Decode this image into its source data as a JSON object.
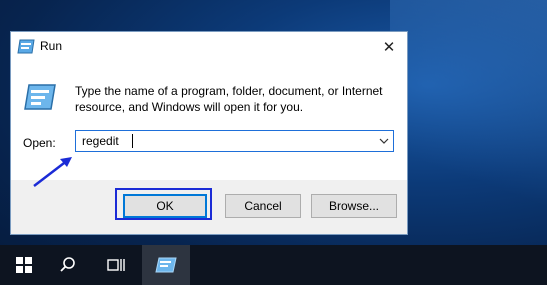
{
  "dialog": {
    "title": "Run",
    "description": "Type the name of a program, folder, document, or Internet resource, and Windows will open it for you.",
    "open_label": "Open:",
    "open_value": "regedit",
    "ok_label": "OK",
    "cancel_label": "Cancel",
    "browse_label": "Browse...",
    "close_glyph": "✕"
  },
  "colors": {
    "accent": "#0078d7",
    "highlight_box": "#1b2bd6",
    "arrow": "#1b2bd6",
    "taskbar": "#0d1420"
  },
  "taskbar": {
    "icons": [
      "windows-start-icon",
      "search-icon",
      "task-view-icon",
      "run-app-icon"
    ]
  }
}
